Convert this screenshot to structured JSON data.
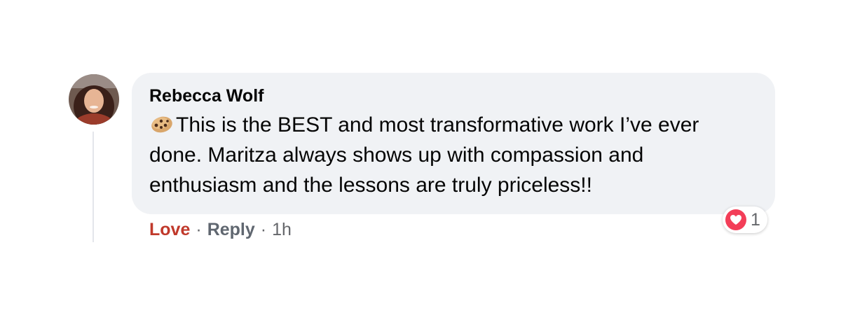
{
  "comment": {
    "author": "Rebecca Wolf",
    "emoji": "cookie-emoji",
    "text": "This is the BEST and most transformative work I’ve ever done. Maritza always shows up with compassion and enthusiasm and the lessons are truly priceless!!",
    "reactions": {
      "icon": "heart-icon",
      "count": "1"
    },
    "actions": {
      "love_label": "Love",
      "separator": "·",
      "reply_label": "Reply",
      "timestamp": "1h"
    }
  },
  "colors": {
    "bubble": "#f0f2f5",
    "love_action": "#c0392b",
    "love_reaction": "#f33e58",
    "muted_text": "#65676b"
  }
}
